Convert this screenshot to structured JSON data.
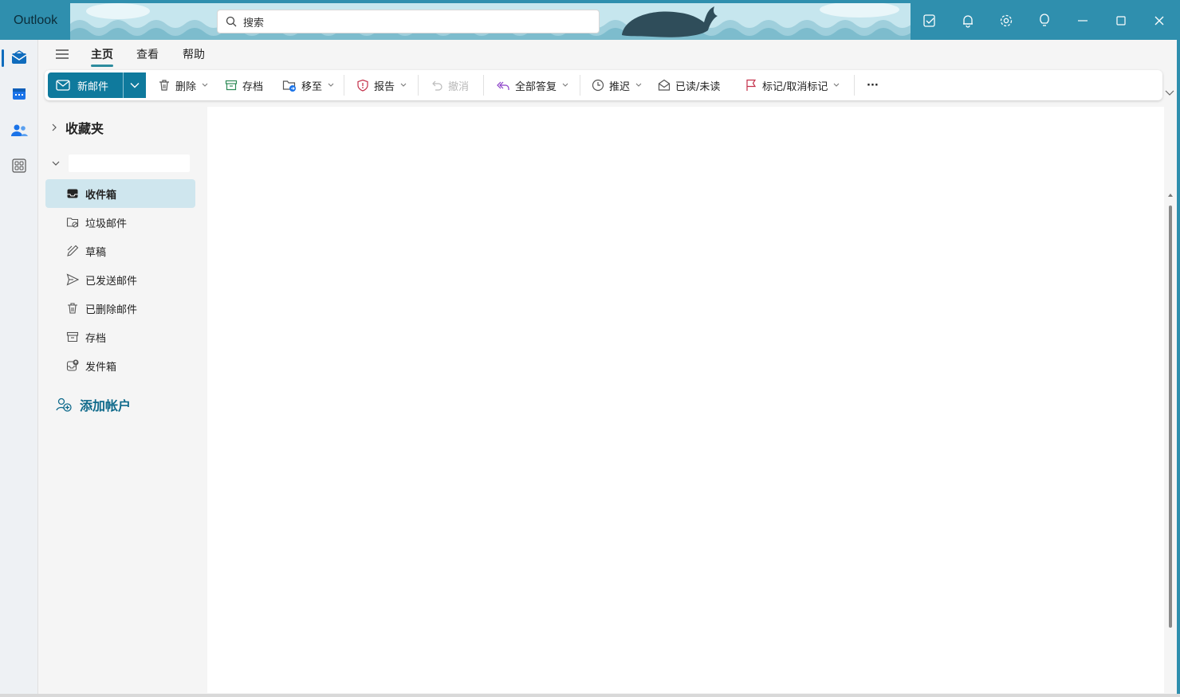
{
  "app": {
    "name": "Outlook"
  },
  "search": {
    "placeholder": "搜索"
  },
  "window_controls": [
    "my-day-icon",
    "bell-icon",
    "gear-icon",
    "lightbulb-icon",
    "minimize-icon",
    "maximize-icon",
    "close-icon"
  ],
  "rail": {
    "items": [
      "mail-icon",
      "calendar-icon",
      "people-icon",
      "apps-icon"
    ],
    "active": "mail-icon"
  },
  "tabs": [
    {
      "label": "主页",
      "active": true
    },
    {
      "label": "查看"
    },
    {
      "label": "帮助"
    }
  ],
  "ribbon": {
    "new_mail": "新邮件",
    "delete": "删除",
    "archive": "存档",
    "move_to": "移至",
    "report": "报告",
    "undo": "撤消",
    "reply_all": "全部答复",
    "snooze": "推迟",
    "read_unread": "已读/未读",
    "flag": "标记/取消标记",
    "more": "···"
  },
  "folder_pane": {
    "favorites": "收藏夹",
    "account_name": "",
    "folders": [
      {
        "label": "收件箱",
        "icon": "inbox-icon",
        "active": true
      },
      {
        "label": "垃圾邮件",
        "icon": "junk-icon"
      },
      {
        "label": "草稿",
        "icon": "drafts-icon"
      },
      {
        "label": "已发送邮件",
        "icon": "sent-icon"
      },
      {
        "label": "已删除邮件",
        "icon": "trash-icon"
      },
      {
        "label": "存档",
        "icon": "archive-icon"
      },
      {
        "label": "发件箱",
        "icon": "outbox-icon"
      }
    ],
    "add_account": "添加帐户"
  },
  "colors": {
    "accent": "#0f7a9d",
    "titlebar": "#2f8fae",
    "selected_folder": "#cfe6ee",
    "link": "#0f6a8b"
  }
}
